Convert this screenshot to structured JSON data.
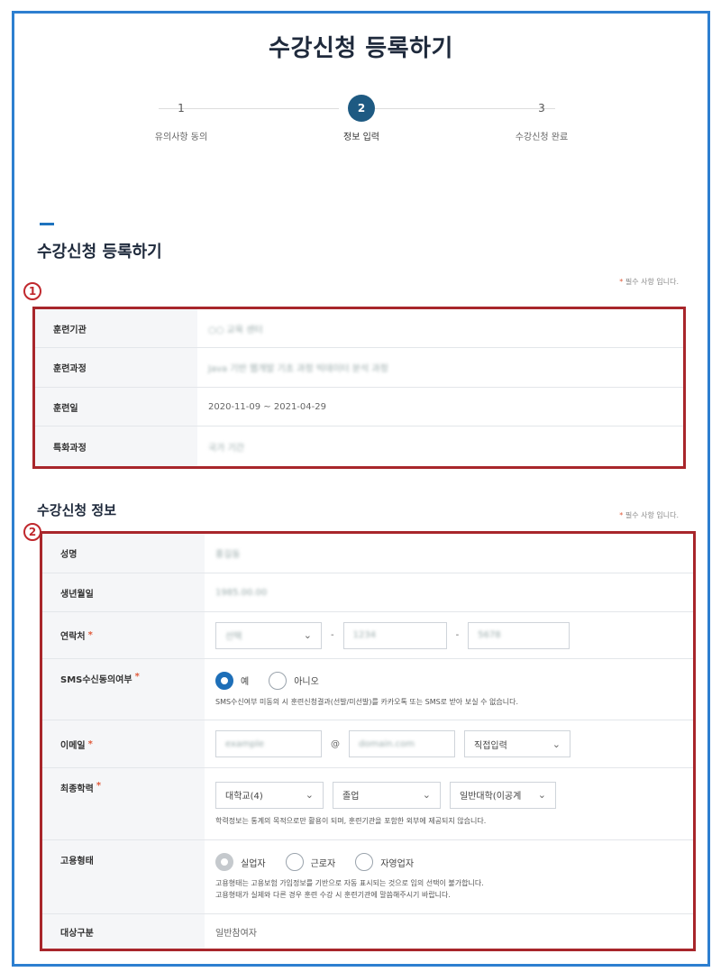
{
  "page": {
    "title": "수강신청 등록하기"
  },
  "steps": [
    {
      "number": "1",
      "label": "유의사항 동의"
    },
    {
      "number": "2",
      "label": "정보 입력"
    },
    {
      "number": "3",
      "label": "수강신청 완료"
    }
  ],
  "section1": {
    "title": "수강신청 등록하기",
    "required_note_star": "*",
    "required_note_text": "필수 사항 입니다.",
    "marker": "1",
    "rows": [
      {
        "label": "훈련기관",
        "value": "○○ 교육 센터"
      },
      {
        "label": "훈련과정",
        "value": "Java 기반 웹개발 기초 과정 빅데이터 분석 과정"
      },
      {
        "label": "훈련일",
        "value": "2020-11-09 ~ 2021-04-29"
      },
      {
        "label": "특화과정",
        "value": "국가 기간"
      }
    ]
  },
  "section2": {
    "title": "수강신청 정보",
    "required_note_star": "*",
    "required_note_text": "필수 사항 입니다.",
    "marker": "2",
    "required_mark": "*",
    "name": {
      "label": "성명",
      "value": "홍길동"
    },
    "birth": {
      "label": "생년월일",
      "value": "1985.00.00"
    },
    "phone": {
      "label": "연락처",
      "first": "선택",
      "middle": "1234",
      "last": "5678"
    },
    "sms": {
      "label": "SMS수신동의여부",
      "options": [
        "예",
        "아니오"
      ],
      "help": "SMS수신여부 미동의 시 훈련신청결과(선발/미선발)를 카카오톡 또는 SMS로 받아 보실 수 없습니다."
    },
    "email": {
      "label": "이메일",
      "id": "example",
      "at": "@",
      "domain": "domain.com",
      "select": "직접입력"
    },
    "education": {
      "label": "최종학력",
      "school": "대학교(4)",
      "status": "졸업",
      "type": "일반대학(이공계",
      "help": "학력정보는 통계의 목적으로만 활용이 되며, 훈련기관을 포함한 외부에 제공되지 않습니다."
    },
    "employment": {
      "label": "고용형태",
      "options": [
        "실업자",
        "근로자",
        "자영업자"
      ],
      "help1": "고용형태는 고용보험 가입정보를 기반으로 자동 표시되는 것으로 임의 선택이 불가합니다.",
      "help2": "고용형태가 실제와 다른 경우 훈련 수강 시 훈련기관에 말씀해주시기 바랍니다."
    },
    "target": {
      "label": "대상구분",
      "value": "일반참여자"
    }
  },
  "colors": {
    "accent": "#1e5a82",
    "frame": "#2d7fd0",
    "highlight": "#a8262b",
    "required": "#e05a3a"
  }
}
